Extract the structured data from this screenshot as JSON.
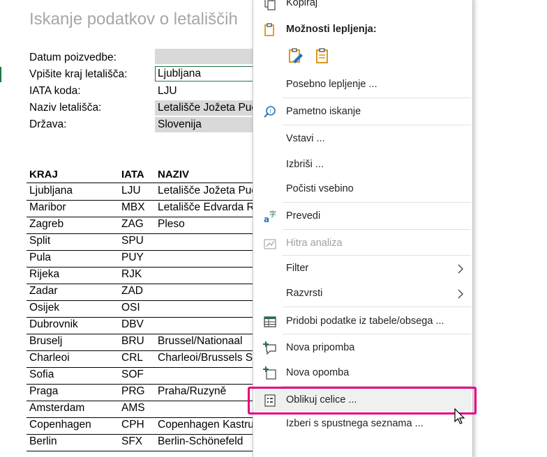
{
  "sheet": {
    "title": "Iskanje podatkov o letališčih",
    "fields": [
      {
        "label": "Datum poizvedbe:",
        "value": ""
      },
      {
        "label": "Vpišite kraj letališča:",
        "value": "Ljubljana"
      },
      {
        "label": "IATA koda:",
        "value": "LJU"
      },
      {
        "label": "Naziv letališča:",
        "value": "Letališče Jožeta Puč"
      },
      {
        "label": "Država:",
        "value": "Slovenija"
      }
    ],
    "table": {
      "headers": [
        "KRAJ",
        "IATA",
        "NAZIV"
      ],
      "rows": [
        [
          "Ljubljana",
          "LJU",
          "Letališče Jožeta Pučnik"
        ],
        [
          "Maribor",
          "MBX",
          "Letališče Edvarda Rusjan"
        ],
        [
          "Zagreb",
          "ZAG",
          "Pleso"
        ],
        [
          "Split",
          "SPU",
          ""
        ],
        [
          "Pula",
          "PUY",
          ""
        ],
        [
          "Rijeka",
          "RJK",
          ""
        ],
        [
          "Zadar",
          "ZAD",
          ""
        ],
        [
          "Osijek",
          "OSI",
          ""
        ],
        [
          "Dubrovnik",
          "DBV",
          ""
        ],
        [
          "Bruselj",
          "BRU",
          "Brussel/Nationaal"
        ],
        [
          "Charleoi",
          "CRL",
          "Charleoi/Brussels South"
        ],
        [
          "Sofia",
          "SOF",
          ""
        ],
        [
          "Praga",
          "PRG",
          "Praha/Ruzyně"
        ],
        [
          "Amsterdam",
          "AMS",
          ""
        ],
        [
          "Copenhagen",
          "CPH",
          "Copenhagen Kastrup"
        ],
        [
          "Berlin",
          "SFX",
          "Berlin-Schönefeld"
        ]
      ]
    }
  },
  "menu": {
    "copy": "Kopiraj",
    "paste_options": "Možnosti lepljenja:",
    "paste_special": "Posebno lepljenje ...",
    "smart_lookup": "Pametno iskanje",
    "insert": "Vstavi ...",
    "delete": "Izbriši ...",
    "clear_contents": "Počisti vsebino",
    "translate": "Prevedi",
    "quick_analysis": "Hitra analiza",
    "filter": "Filter",
    "sort": "Razvrsti",
    "get_data": "Pridobi podatke iz tabele/obsega ...",
    "new_comment": "Nova pripomba",
    "new_note": "Nova opomba",
    "format_cells": "Oblikuj celice ...",
    "pick_from_list": "Izberi s spustnega seznama ..."
  },
  "colors": {
    "highlight": "#e6007e",
    "accent_green": "#217346",
    "icon_orange": "#d98a00",
    "icon_blue": "#1e73be",
    "title_gray": "#a6a6a6"
  }
}
